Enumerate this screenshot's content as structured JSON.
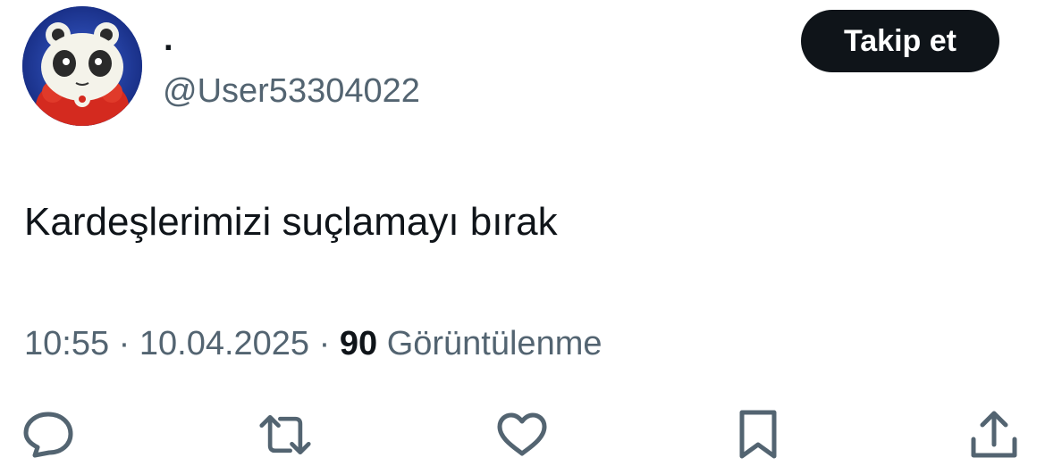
{
  "author": {
    "display_name": "·",
    "handle": "@User53304022",
    "avatar_icon": "teddie-mascot-avatar"
  },
  "follow_button": {
    "label": "Takip et"
  },
  "tweet": {
    "text": "Kardeşlerimizi suçlamayı bırak"
  },
  "meta": {
    "time": "10:55",
    "separator": " · ",
    "date": "10.04.2025",
    "views_count": "90",
    "views_label": "Görüntülenme"
  },
  "actions": [
    {
      "icon": "reply-icon"
    },
    {
      "icon": "retweet-icon"
    },
    {
      "icon": "like-icon"
    },
    {
      "icon": "bookmark-icon"
    },
    {
      "icon": "share-icon"
    }
  ],
  "colors": {
    "text_primary": "#0f1419",
    "text_secondary": "#536471",
    "button_bg": "#0f1419",
    "button_text": "#ffffff",
    "background": "#ffffff"
  }
}
